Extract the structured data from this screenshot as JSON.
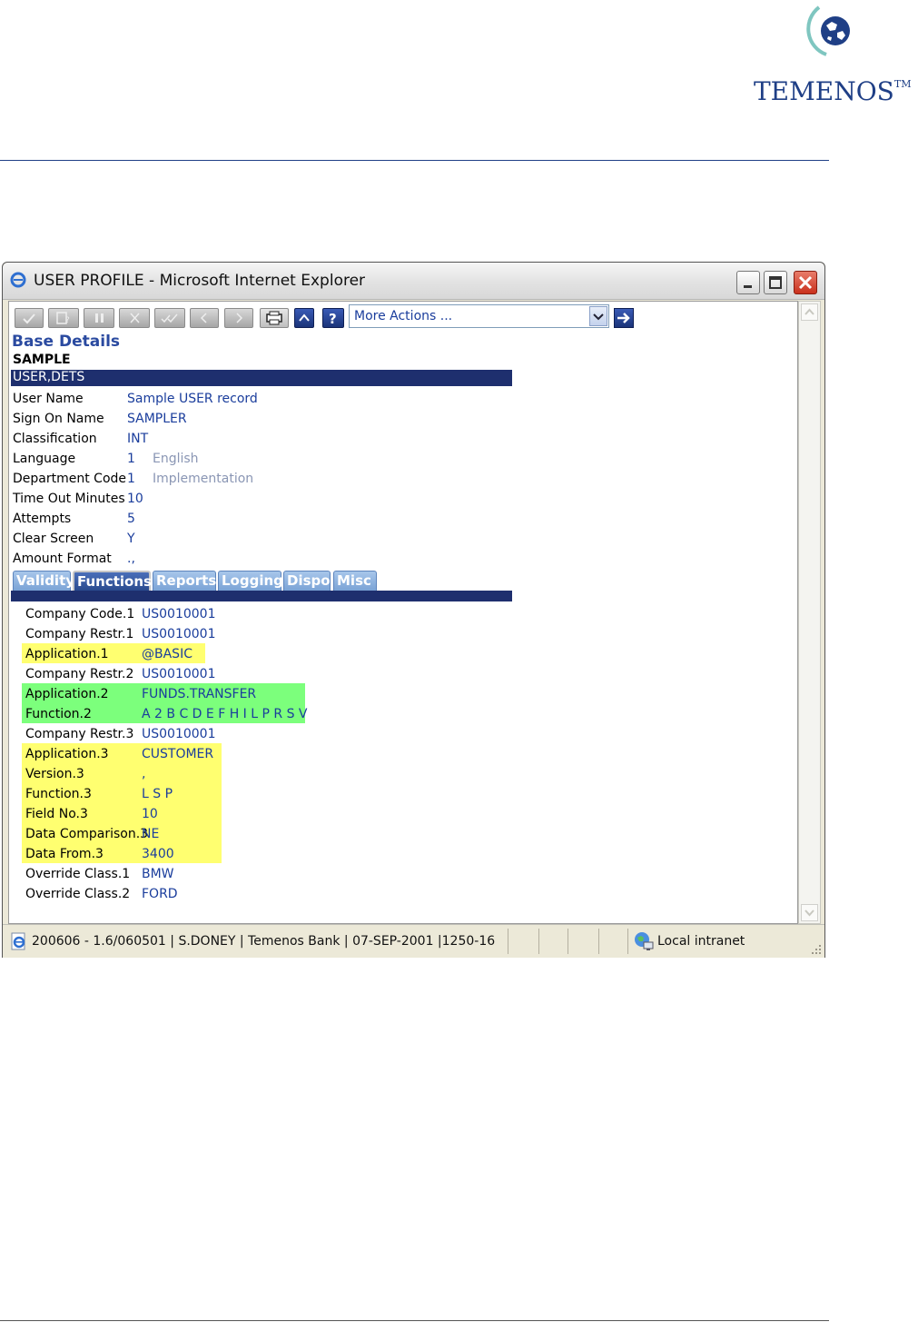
{
  "logo": {
    "text": "TEMENOS",
    "tm": "TM"
  },
  "window": {
    "title": "USER PROFILE - Microsoft Internet Explorer"
  },
  "toolbar": {
    "actions_select": "More Actions ..."
  },
  "record": {
    "section_title": "Base Details",
    "record_id": "SAMPLE",
    "header_bar": "USER,DETS",
    "fields": [
      {
        "label": "User Name",
        "value": "Sample USER record"
      },
      {
        "label": "Sign On Name",
        "value": "SAMPLER"
      },
      {
        "label": "Classification",
        "value": "INT"
      },
      {
        "label": "Language",
        "value": "1",
        "enrichment": "English"
      },
      {
        "label": "Department Code",
        "value": "1",
        "enrichment": "Implementation"
      },
      {
        "label": "Time Out Minutes",
        "value": "10"
      },
      {
        "label": "Attempts",
        "value": "5"
      },
      {
        "label": "Clear Screen",
        "value": "Y"
      },
      {
        "label": "Amount Format",
        "value": ".,"
      }
    ]
  },
  "tabs": [
    {
      "label": "Validity"
    },
    {
      "label": "Functions",
      "active": true
    },
    {
      "label": "Reports"
    },
    {
      "label": "Logging"
    },
    {
      "label": "Dispo"
    },
    {
      "label": "Misc"
    }
  ],
  "functions": [
    {
      "label": "Company Code.1",
      "value": "US0010001"
    },
    {
      "label": "Company Restr.1",
      "value": "US0010001"
    },
    {
      "label": "Application.1",
      "value": "@BASIC"
    },
    {
      "label": "Company Restr.2",
      "value": "US0010001"
    },
    {
      "label": "Application.2",
      "value": "FUNDS.TRANSFER"
    },
    {
      "label": "Function.2",
      "value": "A 2 B C D E F H I L P R S V"
    },
    {
      "label": "Company Restr.3",
      "value": "US0010001"
    },
    {
      "label": "Application.3",
      "value": "CUSTOMER"
    },
    {
      "label": "Version.3",
      "value": ","
    },
    {
      "label": "Function.3",
      "value": "L S P"
    },
    {
      "label": "Field No.3",
      "value": "10"
    },
    {
      "label": "Data Comparison.3",
      "value": "NE"
    },
    {
      "label": "Data From.3",
      "value": "3400"
    },
    {
      "label": "Override Class.1",
      "value": "BMW"
    },
    {
      "label": "Override Class.2",
      "value": "FORD"
    }
  ],
  "statusbar": {
    "text": "200606 - 1.6/060501 | S.DONEY | Temenos Bank | 07-SEP-2001 |1250-16",
    "zone": "Local intranet"
  },
  "colors": {
    "brand": "#1f3f86",
    "highlight_yellow": "#ffff70",
    "highlight_green": "#7cff7c"
  }
}
